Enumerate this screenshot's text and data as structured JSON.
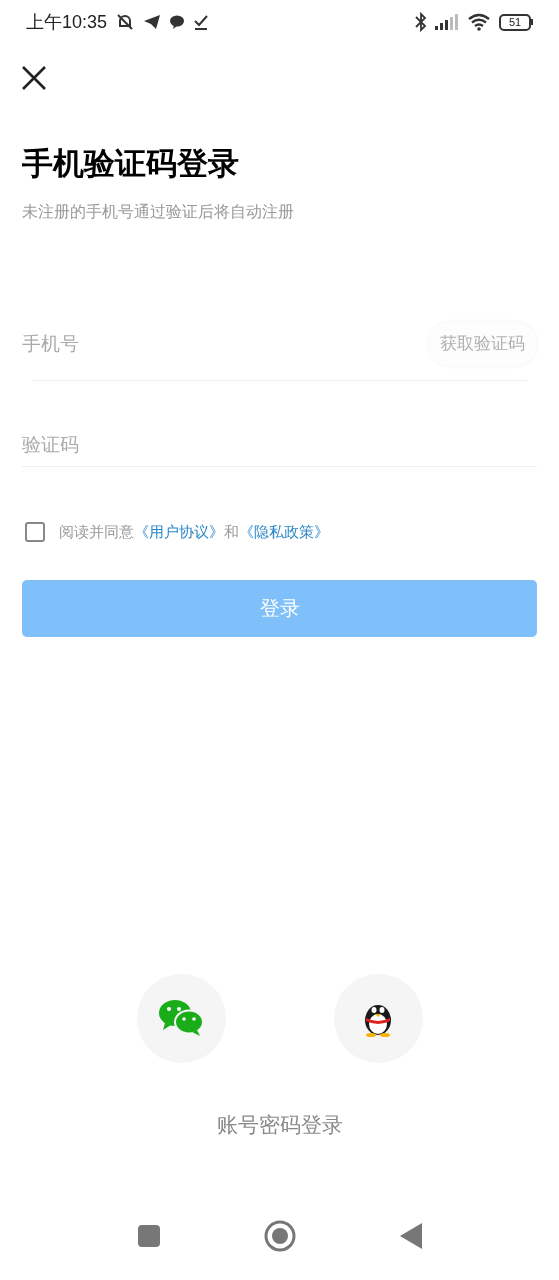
{
  "status_bar": {
    "time": "上午10:35",
    "battery": "51"
  },
  "title": "手机验证码登录",
  "subtitle": "未注册的手机号通过验证后将自动注册",
  "phone_field": {
    "placeholder": "手机号",
    "code_button": "获取验证码",
    "disabled": true
  },
  "code_field": {
    "placeholder": "验证码"
  },
  "agreement": {
    "checked": false,
    "parts": [
      {
        "kind": "text",
        "text": "阅读并同意"
      },
      {
        "kind": "link",
        "text": "《用户协议》"
      },
      {
        "kind": "text",
        "text": "和"
      },
      {
        "kind": "link",
        "text": "《隐私政策》"
      }
    ]
  },
  "login_button": {
    "label": "登录",
    "disabled": true
  },
  "social_logins": [
    {
      "kind": "wechat"
    },
    {
      "kind": "qq"
    }
  ],
  "alt_login": "账号密码登录"
}
